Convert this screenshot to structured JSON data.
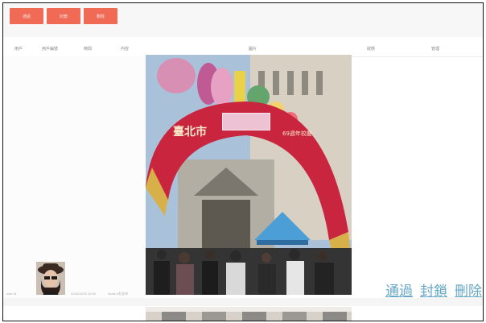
{
  "toolbar": {
    "buttons": [
      "通過",
      "封鎖",
      "刪除"
    ]
  },
  "table": {
    "headers": [
      "用戶",
      "用戶編號",
      "時間",
      "內容",
      "圖片",
      "狀態",
      "管理"
    ]
  },
  "row": {
    "user_id_text": "user id",
    "time_text": "2016/11/24 12:00",
    "content_text": "#vote #台北市"
  },
  "photo": {
    "banner_text": "臺北市",
    "banner_right_text": "69週年校慶"
  },
  "actions": {
    "approve": "通過",
    "block": "封鎖",
    "delete": "刪除"
  },
  "colors": {
    "accent": "#f06a55",
    "link": "#66a8c8"
  }
}
